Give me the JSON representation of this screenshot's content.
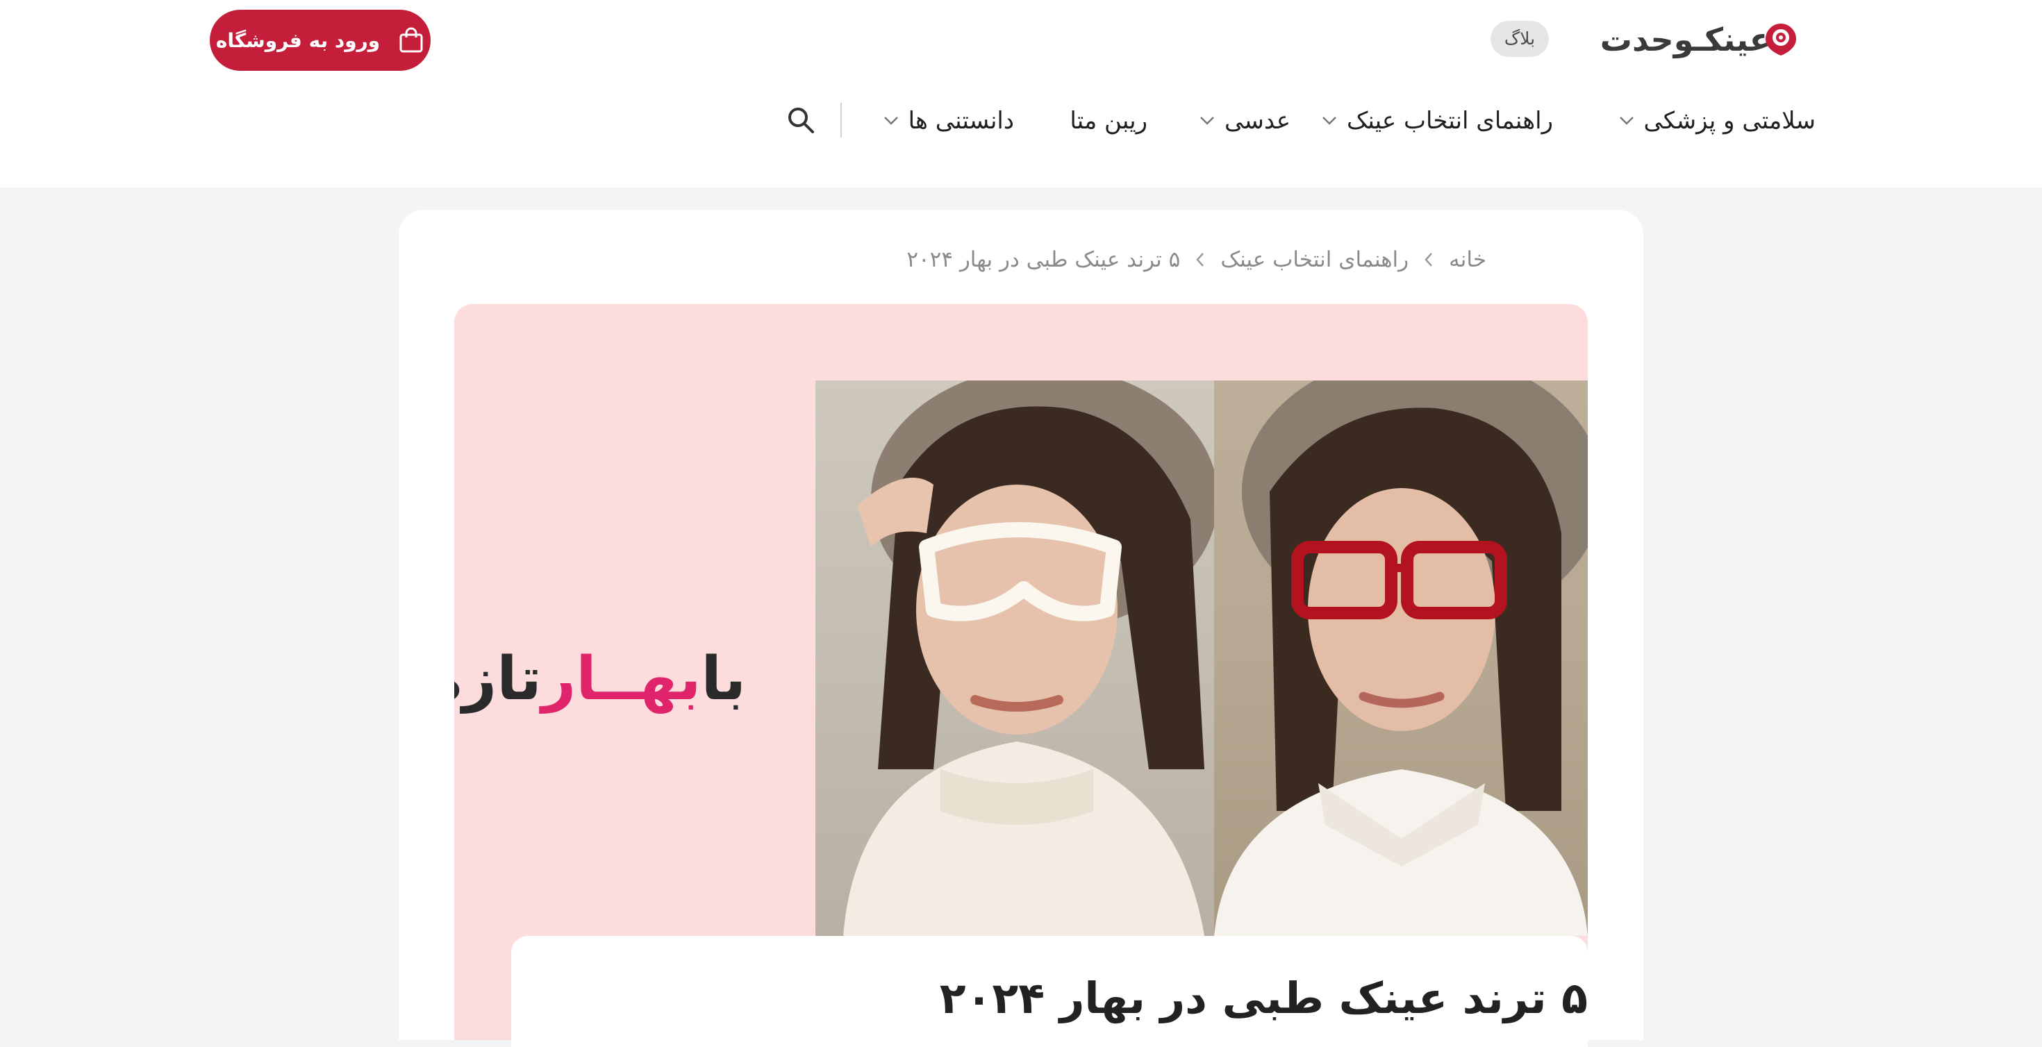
{
  "header": {
    "logo_text": "عینکـوحدت",
    "blog_label": "بلاگ",
    "shop_button_label": "ورود به فروشگاه",
    "nav": [
      {
        "label": "سلامتی و پزشکی",
        "has_dropdown": true
      },
      {
        "label": "راهنمای انتخاب عینک",
        "has_dropdown": true
      },
      {
        "label": "عدسی",
        "has_dropdown": true
      },
      {
        "label": "ریبن متا",
        "has_dropdown": false
      },
      {
        "label": "دانستنی ها",
        "has_dropdown": true
      }
    ],
    "icons": {
      "search": "search-icon",
      "bag": "shopping-bag-icon"
    }
  },
  "breadcrumb": {
    "items": [
      "خانه",
      "راهنمای انتخاب عینک",
      "۵ ترند عینک طبی در بهار ۲۰۲۴"
    ],
    "separator": "chevron-left-icon"
  },
  "hero": {
    "slogan_dark_1": "با",
    "slogan_pink": "بهــار",
    "slogan_dark_2": "تازه شو"
  },
  "post": {
    "title": "۵ ترند عینک طبی در بهار ۲۰۲۴"
  },
  "colors": {
    "brand_red": "#c41e3a",
    "slogan_pink": "#e0246b",
    "hero_bg": "#fcdcdc",
    "page_bg": "#f3f4f6"
  }
}
